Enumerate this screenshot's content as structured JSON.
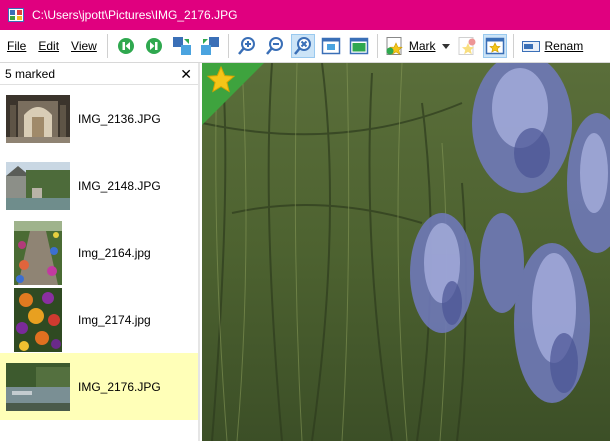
{
  "window": {
    "title": "C:\\Users\\jpott\\Pictures\\IMG_2176.JPG"
  },
  "menu": [
    {
      "label": "File"
    },
    {
      "label": "Edit"
    },
    {
      "label": "View"
    }
  ],
  "toolbar": {
    "mark_label": "Mark",
    "rename_label": "Renam"
  },
  "panel": {
    "header": "5 marked",
    "close": "✕",
    "items": [
      {
        "name": "IMG_2136.JPG"
      },
      {
        "name": "IMG_2148.JPG"
      },
      {
        "name": "Img_2164.jpg"
      },
      {
        "name": "Img_2174.jpg"
      },
      {
        "name": "IMG_2176.JPG",
        "selected": true
      }
    ]
  },
  "colors": {
    "titlebar": "#e0007f",
    "selected": "#ffffb8",
    "mark_corner": "#3ea33e",
    "star": "#f5c518"
  }
}
